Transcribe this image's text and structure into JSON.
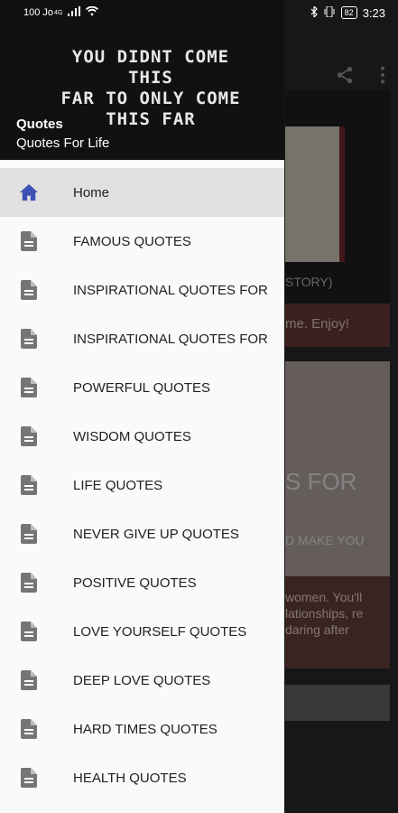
{
  "status_bar": {
    "left_text": "100 Jo",
    "network": "4G",
    "battery": "82",
    "time": "3:23"
  },
  "drawer": {
    "header": {
      "image_text_line1": "YOU DIDNT COME THIS",
      "image_text_line2": "FAR TO ONLY COME",
      "image_text_line3": "THIS FAR",
      "title": "Quotes",
      "subtitle": "Quotes For Life"
    },
    "items": [
      {
        "label": "Home",
        "icon": "home-icon"
      },
      {
        "label": "FAMOUS QUOTES",
        "icon": "document-icon"
      },
      {
        "label": "INSPIRATIONAL QUOTES FOR",
        "icon": "document-icon"
      },
      {
        "label": "INSPIRATIONAL QUOTES FOR",
        "icon": "document-icon"
      },
      {
        "label": "POWERFUL QUOTES",
        "icon": "document-icon"
      },
      {
        "label": "WISDOM QUOTES",
        "icon": "document-icon"
      },
      {
        "label": "LIFE QUOTES",
        "icon": "document-icon"
      },
      {
        "label": "NEVER GIVE UP QUOTES",
        "icon": "document-icon"
      },
      {
        "label": "POSITIVE QUOTES",
        "icon": "document-icon"
      },
      {
        "label": "LOVE YOURSELF QUOTES",
        "icon": "document-icon"
      },
      {
        "label": "DEEP LOVE QUOTES",
        "icon": "document-icon"
      },
      {
        "label": "HARD TIMES QUOTES",
        "icon": "document-icon"
      },
      {
        "label": "HEALTH QUOTES",
        "icon": "document-icon"
      }
    ]
  },
  "background": {
    "card1_caption": "STORY)",
    "card1_band": "me. Enjoy!",
    "card2_big": "S FOR",
    "card2_small": "D MAKE YOU",
    "card2_band": "women. You'll lationships, re daring after"
  },
  "colors": {
    "active_icon": "#3f51b5",
    "icon": "#757575",
    "active_bg": "#e0e0e0"
  }
}
